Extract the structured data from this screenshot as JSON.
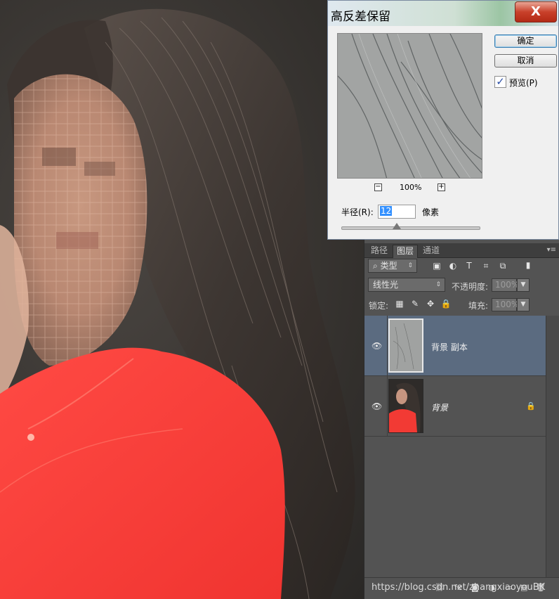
{
  "dialog": {
    "title": "高反差保留",
    "close_glyph": "X",
    "ok_label": "确定",
    "cancel_label": "取消",
    "preview_label": "预览(P)",
    "preview_checked": true,
    "zoom_out_glyph": "−",
    "zoom_in_glyph": "+",
    "zoom_level": "100%",
    "radius_label": "半径(R):",
    "radius_value": "12",
    "radius_unit": "像素"
  },
  "layers_panel": {
    "tabs": [
      {
        "label": "路径",
        "active": false
      },
      {
        "label": "图层",
        "active": true
      },
      {
        "label": "通道",
        "active": false
      }
    ],
    "menu_glyph": "▾≡",
    "filter_kind": "类型",
    "filter_search_glyph": "⌕",
    "blend_mode": "线性光",
    "opacity_label": "不透明度:",
    "opacity_value": "100%",
    "lock_label": "锁定:",
    "fill_label": "填充:",
    "fill_value": "100%",
    "layers": [
      {
        "name": "背景 副本",
        "selected": true,
        "visible": true,
        "locked": false
      },
      {
        "name": "背景",
        "selected": false,
        "visible": true,
        "locked": true
      }
    ]
  },
  "watermark": "https://blog.csdn.net/zhangxiaoyouBK",
  "icons": {
    "eye": "👁",
    "lock": "🔒"
  }
}
